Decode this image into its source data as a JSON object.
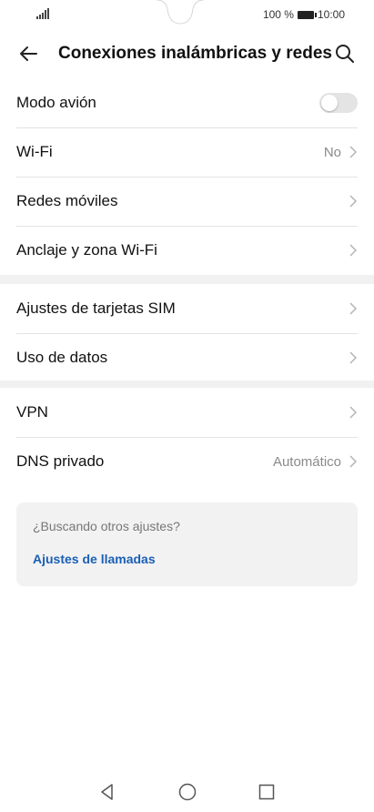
{
  "status": {
    "battery_text": "100 %",
    "time": "10:00"
  },
  "appbar": {
    "title": "Conexiones inalámbricas y redes"
  },
  "group1": [
    {
      "label": "Modo avión",
      "value": "",
      "control": "toggle",
      "toggle_on": false
    },
    {
      "label": "Wi-Fi",
      "value": "No",
      "control": "chevron"
    },
    {
      "label": "Redes móviles",
      "value": "",
      "control": "chevron"
    },
    {
      "label": "Anclaje y zona Wi-Fi",
      "value": "",
      "control": "chevron"
    }
  ],
  "group2": [
    {
      "label": "Ajustes de tarjetas SIM",
      "value": "",
      "control": "chevron"
    },
    {
      "label": "Uso de datos",
      "value": "",
      "control": "chevron"
    }
  ],
  "group3": [
    {
      "label": "VPN",
      "value": "",
      "control": "chevron"
    },
    {
      "label": "DNS privado",
      "value": "Automático",
      "control": "chevron"
    }
  ],
  "suggestion": {
    "question": "¿Buscando otros ajustes?",
    "link": "Ajustes de llamadas"
  },
  "colors": {
    "link": "#1a5fb4",
    "section_gap": "#f1f1f1"
  }
}
